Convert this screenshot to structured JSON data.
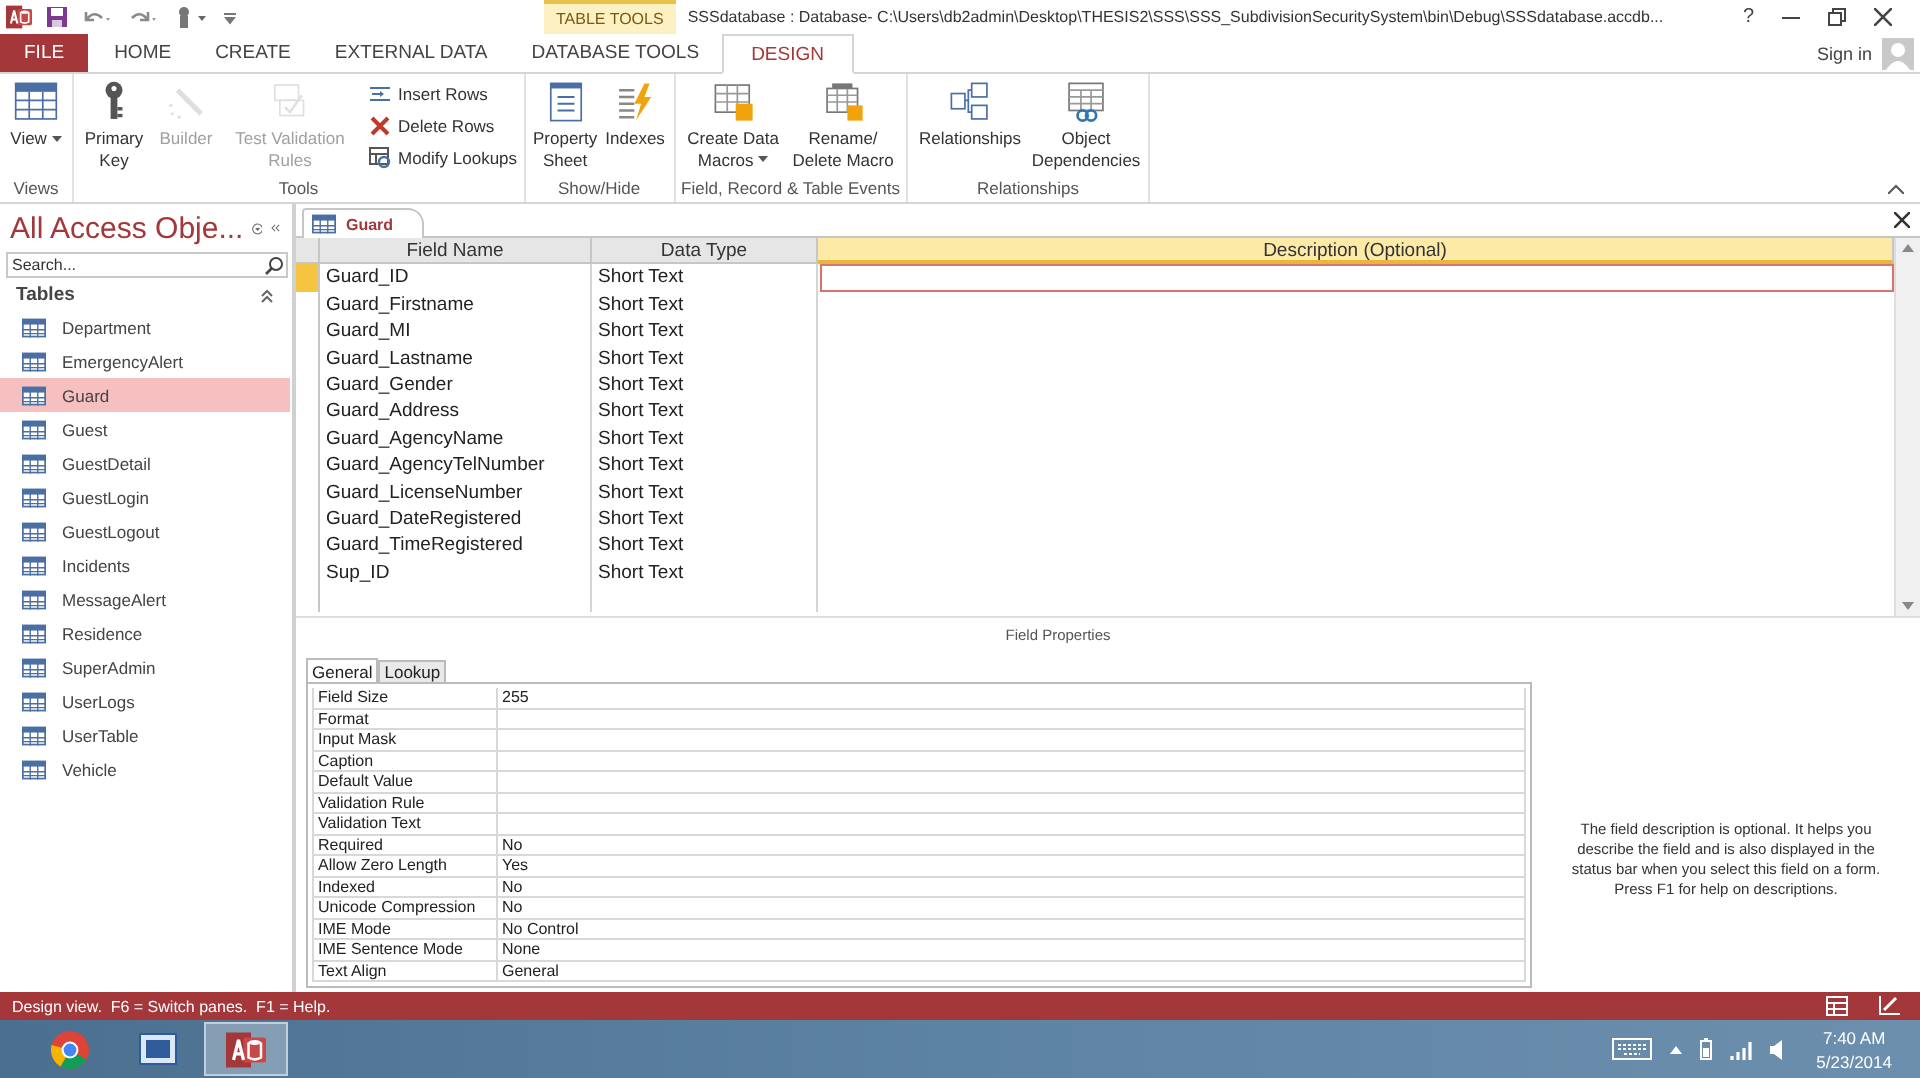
{
  "title_bar": {
    "contextual_group": "TABLE TOOLS",
    "title": "SSSdatabase : Database- C:\\Users\\db2admin\\Desktop\\THESIS2\\SSS\\SSS_SubdivisionSecuritySystem\\bin\\Debug\\SSSdatabase.accdb...",
    "help": "?"
  },
  "ribbon_tabs": [
    {
      "label": "FILE",
      "kind": "file",
      "selected": false
    },
    {
      "label": "HOME",
      "kind": "tab",
      "selected": false
    },
    {
      "label": "CREATE",
      "kind": "tab",
      "selected": false
    },
    {
      "label": "EXTERNAL DATA",
      "kind": "tab",
      "selected": false
    },
    {
      "label": "DATABASE TOOLS",
      "kind": "tab",
      "selected": false
    },
    {
      "label": "DESIGN",
      "kind": "tab",
      "selected": true
    }
  ],
  "sign_in": "Sign in",
  "ribbon_groups": [
    {
      "label": "Views",
      "commands": [
        {
          "label": "View",
          "kind": "large",
          "dropdown": true,
          "disabled": false
        }
      ]
    },
    {
      "label": "Tools",
      "commands": [
        {
          "label": "Primary Key",
          "kind": "large",
          "dropdown": false,
          "disabled": false
        },
        {
          "label": "Builder",
          "kind": "large",
          "dropdown": false,
          "disabled": true
        },
        {
          "label": "Test Validation Rules",
          "kind": "large",
          "dropdown": false,
          "disabled": true
        },
        {
          "label": "Insert Rows",
          "kind": "small",
          "dropdown": false,
          "disabled": false
        },
        {
          "label": "Delete Rows",
          "kind": "small",
          "dropdown": false,
          "disabled": false
        },
        {
          "label": "Modify Lookups",
          "kind": "small",
          "dropdown": false,
          "disabled": false
        }
      ]
    },
    {
      "label": "Show/Hide",
      "commands": [
        {
          "label": "Property Sheet",
          "kind": "large",
          "dropdown": false,
          "disabled": false
        },
        {
          "label": "Indexes",
          "kind": "large",
          "dropdown": false,
          "disabled": false
        }
      ]
    },
    {
      "label": "Field, Record & Table Events",
      "commands": [
        {
          "label": "Create Data Macros",
          "kind": "large",
          "dropdown": true,
          "disabled": false
        },
        {
          "label": "Rename/ Delete Macro",
          "kind": "large",
          "dropdown": false,
          "disabled": false
        }
      ]
    },
    {
      "label": "Relationships",
      "commands": [
        {
          "label": "Relationships",
          "kind": "large",
          "dropdown": false,
          "disabled": false
        },
        {
          "label": "Object Dependencies",
          "kind": "large",
          "dropdown": false,
          "disabled": false
        }
      ]
    }
  ],
  "nav_pane": {
    "title": "All Access Obje...",
    "search_placeholder": "Search...",
    "section": "Tables",
    "items": [
      {
        "label": "Department",
        "selected": false
      },
      {
        "label": "EmergencyAlert",
        "selected": false
      },
      {
        "label": "Guard",
        "selected": true
      },
      {
        "label": "Guest",
        "selected": false
      },
      {
        "label": "GuestDetail",
        "selected": false
      },
      {
        "label": "GuestLogin",
        "selected": false
      },
      {
        "label": "GuestLogout",
        "selected": false
      },
      {
        "label": "Incidents",
        "selected": false
      },
      {
        "label": "MessageAlert",
        "selected": false
      },
      {
        "label": "Residence",
        "selected": false
      },
      {
        "label": "SuperAdmin",
        "selected": false
      },
      {
        "label": "UserLogs",
        "selected": false
      },
      {
        "label": "UserTable",
        "selected": false
      },
      {
        "label": "Vehicle",
        "selected": false
      }
    ]
  },
  "document_tab": {
    "label": "Guard"
  },
  "field_grid": {
    "columns": [
      "Field Name",
      "Data Type",
      "Description (Optional)"
    ],
    "rows": [
      {
        "field_name": "Guard_ID",
        "data_type": "Short Text",
        "selected": true
      },
      {
        "field_name": "Guard_Firstname",
        "data_type": "Short Text",
        "selected": false
      },
      {
        "field_name": "Guard_MI",
        "data_type": "Short Text",
        "selected": false
      },
      {
        "field_name": "Guard_Lastname",
        "data_type": "Short Text",
        "selected": false
      },
      {
        "field_name": "Guard_Gender",
        "data_type": "Short Text",
        "selected": false
      },
      {
        "field_name": "Guard_Address",
        "data_type": "Short Text",
        "selected": false
      },
      {
        "field_name": "Guard_AgencyName",
        "data_type": "Short Text",
        "selected": false
      },
      {
        "field_name": "Guard_AgencyTelNumber",
        "data_type": "Short Text",
        "selected": false
      },
      {
        "field_name": "Guard_LicenseNumber",
        "data_type": "Short Text",
        "selected": false
      },
      {
        "field_name": "Guard_DateRegistered",
        "data_type": "Short Text",
        "selected": false
      },
      {
        "field_name": "Guard_TimeRegistered",
        "data_type": "Short Text",
        "selected": false
      },
      {
        "field_name": "Sup_ID",
        "data_type": "Short Text",
        "selected": false
      }
    ]
  },
  "field_properties": {
    "title": "Field Properties",
    "tabs": [
      {
        "label": "General",
        "selected": true
      },
      {
        "label": "Lookup",
        "selected": false
      }
    ],
    "properties": [
      {
        "name": "Field Size",
        "value": "255"
      },
      {
        "name": "Format"
      },
      {
        "name": "Input Mask"
      },
      {
        "name": "Caption"
      },
      {
        "name": "Default Value"
      },
      {
        "name": "Validation Rule"
      },
      {
        "name": "Validation Text"
      },
      {
        "name": "Required",
        "value": "No"
      },
      {
        "name": "Allow Zero Length",
        "value": "Yes"
      },
      {
        "name": "Indexed",
        "value": "No"
      },
      {
        "name": "Unicode Compression",
        "value": "No"
      },
      {
        "name": "IME Mode",
        "value": "No Control"
      },
      {
        "name": "IME Sentence Mode",
        "value": "None"
      },
      {
        "name": "Text Align",
        "value": "General"
      }
    ],
    "help_text": "The field description is optional. It helps you describe the field and is also displayed in the status bar when you select this field on a form. Press F1 for help on descriptions."
  },
  "status_bar": {
    "text": "Design view.  F6 = Switch panes.  F1 = Help."
  },
  "taskbar": {
    "apps": [
      {
        "kind": "browser",
        "selected": false
      },
      {
        "kind": "studio",
        "selected": false
      },
      {
        "kind": "access",
        "selected": true
      }
    ],
    "time": "7:40 AM",
    "date": "5/23/2014"
  }
}
